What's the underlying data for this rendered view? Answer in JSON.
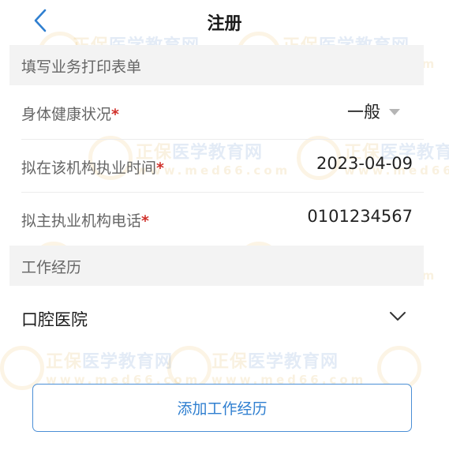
{
  "header": {
    "title": "注册",
    "back_icon": "chevron-left-icon"
  },
  "sections": {
    "print_form": "填写业务打印表单",
    "work_experience": "工作经历"
  },
  "fields": {
    "health": {
      "label": "身体健康状况",
      "required_mark": "*",
      "value": "一般"
    },
    "practice_time": {
      "label": "拟在该机构执业时间",
      "required_mark": "*",
      "value": "2023-04-09"
    },
    "phone": {
      "label": "拟主执业机构电话",
      "required_mark": "*",
      "value": "0101234567"
    }
  },
  "work_items": [
    {
      "name": "口腔医院"
    }
  ],
  "buttons": {
    "add_work": "添加工作经历"
  },
  "watermark": {
    "brand_a": "正保",
    "brand_b": "医学教育网",
    "url": "www.med66.com"
  },
  "colors": {
    "accent": "#2f7fd0",
    "required": "#d0302a",
    "section_bg": "#f3f3f3"
  }
}
